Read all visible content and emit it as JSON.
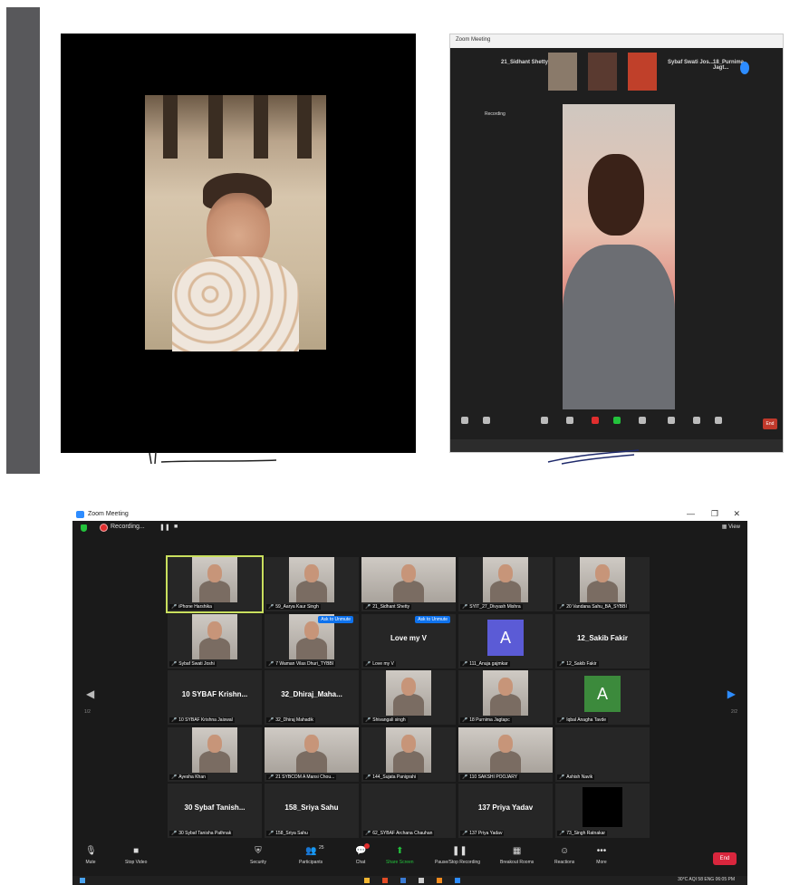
{
  "colors": {
    "zoom_blue": "#2d8cff",
    "recording_red": "#e02e2e",
    "share_green": "#23c23c",
    "end_red": "#d9263d",
    "speaker_outline": "#c9df5e"
  },
  "zoom": {
    "window_title": "Zoom Meeting",
    "recording_label": "Recording...",
    "view_label": "View",
    "pause_icon": "pause-icon",
    "stop_icon": "stop-icon",
    "page_left": "1/2",
    "page_right": "2/2",
    "tiles": [
      {
        "label": "iPhone Harshika",
        "kind": "video",
        "active": true
      },
      {
        "label": "59_Aarya Kaur Singh",
        "kind": "video"
      },
      {
        "label": "21_Sidhant Shetty",
        "kind": "video"
      },
      {
        "label": "SYIT_27_Divyash Mishra",
        "kind": "video"
      },
      {
        "label": "20 Vandana Sahu_BA_SYBBI",
        "kind": "video"
      },
      {
        "label": "Sybaf Swati Joshi",
        "kind": "video"
      },
      {
        "label": "7 Waman Vilas Dhuri_TYBBI",
        "kind": "video",
        "unmute": "Ask to Unmute"
      },
      {
        "label": "Love my V",
        "kind": "name",
        "big": "Love my V",
        "unmute": "Ask to Unmute"
      },
      {
        "label": "111_Anuja gajmkar",
        "kind": "avatar",
        "letter": "A",
        "color": "#5b5bd6"
      },
      {
        "label": "12_Sakib Fakir",
        "kind": "name",
        "big": "12_Sakib Fakir"
      },
      {
        "label": "10 SYBAF Krishna Jaiswal",
        "kind": "name",
        "big": "10 SYBAF Krishn..."
      },
      {
        "label": "32_Dhiraj Mahadik",
        "kind": "name",
        "big": "32_Dhiraj_Maha..."
      },
      {
        "label": "Shivangali singh",
        "kind": "video"
      },
      {
        "label": "18 Purnima Jagtapc",
        "kind": "video"
      },
      {
        "label": "Iqbal Anagha Tavde",
        "kind": "avatar",
        "letter": "A",
        "color": "#3c8a3c"
      },
      {
        "label": "Ayesha Khan",
        "kind": "video"
      },
      {
        "label": "21 SYBCOM A Mansi Chou...",
        "kind": "video"
      },
      {
        "label": "144_Sujata Panigrahi",
        "kind": "video"
      },
      {
        "label": "110 SAKSHI POOJARY",
        "kind": "video"
      },
      {
        "label": "Ashish Navik",
        "kind": "empty"
      },
      {
        "label": "30 Sybaf Tanisha Pathnak",
        "kind": "name",
        "big": "30 Sybaf Tanish..."
      },
      {
        "label": "158_Sriya Sahu",
        "kind": "name",
        "big": "158_Sriya Sahu"
      },
      {
        "label": "62_SYBAF Archana Chauhan",
        "kind": "empty"
      },
      {
        "label": "137 Priya Yadav",
        "kind": "name",
        "big": "137 Priya Yadav"
      },
      {
        "label": "73_Singh Ratnakar",
        "kind": "black"
      }
    ],
    "toolbar": {
      "mute": "Mute",
      "stop_video": "Stop Video",
      "security": "Security",
      "participants": "Participants",
      "participants_count": "25",
      "chat": "Chat",
      "share_screen": "Share Screen",
      "pause_stop_recording": "Pause/Stop Recording",
      "breakout_rooms": "Breakout Rooms",
      "reactions": "Reactions",
      "more": "More",
      "end": "End"
    },
    "taskbar": {
      "tray": "30°C AQI 58  ENG  06:05 PM"
    }
  },
  "photo2": {
    "title": "Zoom Meeting",
    "names": [
      "21_Sidhant Shetty",
      "Sybaf Swati Jos...",
      "18_Purnima Jagt..."
    ],
    "recording": "Recording",
    "end": "End"
  }
}
